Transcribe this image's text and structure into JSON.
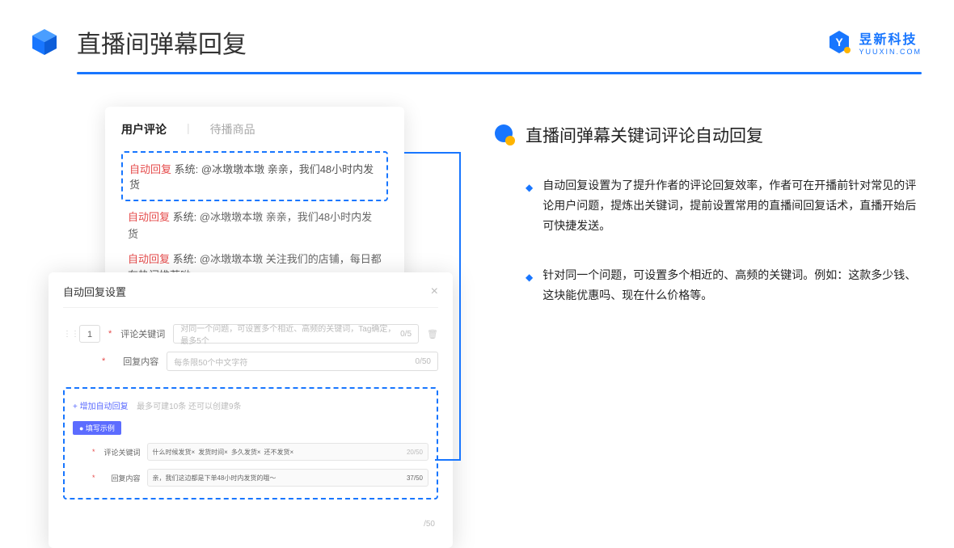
{
  "header": {
    "title": "直播间弹幕回复",
    "brand_cn": "昱新科技",
    "brand_en": "YUUXIN.COM"
  },
  "card1": {
    "tab_active": "用户评论",
    "tab_inactive": "待播商品",
    "tab_sep": "|",
    "auto_tag": "自动回复",
    "sys_prefix": "系统:",
    "comment1": "@冰墩墩本墩 亲亲，我们48小时内发货",
    "comment2": "@冰墩墩本墩 亲亲，我们48小时内发货",
    "comment3": "@冰墩墩本墩 关注我们的店铺，每日都有热门推荐呦～"
  },
  "card2": {
    "title": "自动回复设置",
    "num": "1",
    "star": "*",
    "label_keyword": "评论关键词",
    "placeholder_keyword": "对同一个问题，可设置多个相近、高频的关键词，Tag确定，最多5个",
    "count_keyword": "0/5",
    "label_reply": "回复内容",
    "placeholder_reply": "每条限50个中文字符",
    "count_reply": "0/50",
    "add_link": "+ 增加自动回复",
    "add_hint": "最多可建10条 还可以创建9条",
    "badge": "● 填写示例",
    "ex_label_keyword": "评论关键词",
    "ex_tags": [
      "什么时候发货×",
      "发货时间×",
      "多久发货×",
      "还不发货×"
    ],
    "ex_count_keyword": "20/50",
    "ex_label_reply": "回复内容",
    "ex_reply_text": "亲，我们这边都是下单48小时内发货的哦～",
    "ex_count_reply": "37/50",
    "outer_count": "/50"
  },
  "right": {
    "title": "直播间弹幕关键词评论自动回复",
    "bullet1": "自动回复设置为了提升作者的评论回复效率，作者可在开播前针对常见的评论用户问题，提炼出关键词，提前设置常用的直播间回复话术，直播开始后可快捷发送。",
    "bullet2": "针对同一个问题，可设置多个相近的、高频的关键词。例如：这款多少钱、这块能优惠吗、现在什么价格等。"
  }
}
